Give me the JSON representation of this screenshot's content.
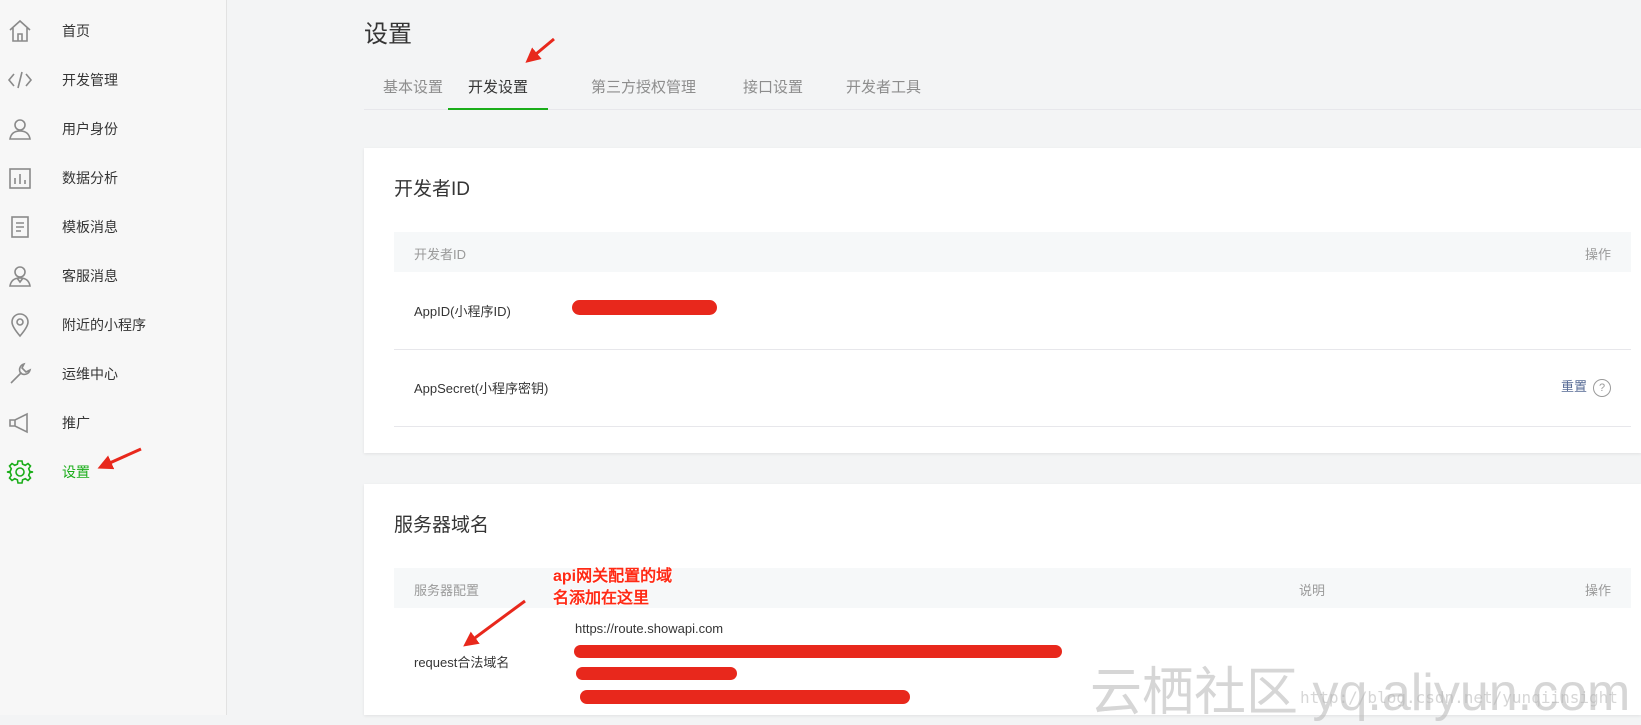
{
  "sidebar": {
    "items": [
      {
        "label": "首页",
        "icon": "home-icon"
      },
      {
        "label": "开发管理",
        "icon": "code-icon"
      },
      {
        "label": "用户身份",
        "icon": "user-icon"
      },
      {
        "label": "数据分析",
        "icon": "bar-chart-icon"
      },
      {
        "label": "模板消息",
        "icon": "document-icon"
      },
      {
        "label": "客服消息",
        "icon": "customer-service-icon"
      },
      {
        "label": "附近的小程序",
        "icon": "location-pin-icon"
      },
      {
        "label": "运维中心",
        "icon": "wrench-icon"
      },
      {
        "label": "推广",
        "icon": "megaphone-icon"
      },
      {
        "label": "设置",
        "icon": "gear-icon",
        "active": true
      }
    ],
    "active_color": "#1aad19"
  },
  "page": {
    "title": "设置"
  },
  "tabs": [
    "基本设置",
    "开发设置",
    "第三方授权管理",
    "接口设置",
    "开发者工具"
  ],
  "active_tab": "开发设置",
  "developer_id": {
    "title": "开发者ID",
    "header": {
      "col1": "开发者ID",
      "action": "操作"
    },
    "rows": {
      "appid_label": "AppID(小程序ID)",
      "secret_label": "AppSecret(小程序密钥)",
      "reset_link": "重置",
      "help_glyph": "?"
    }
  },
  "server_domain": {
    "title": "服务器域名",
    "header": {
      "col1": "服务器配置",
      "desc": "说明",
      "action": "操作"
    },
    "request_label": "request合法域名",
    "domain_first": "https://route.showapi.com"
  },
  "annotation": {
    "line1": "api网关配置的域",
    "line2": "名添加在这里"
  },
  "watermark": {
    "main": "云栖社区 yq.aliyun.com",
    "sub": "http://blog.csdn.net/yunqiinsight"
  },
  "colors": {
    "accent_green": "#1aad19",
    "link_blue": "#576b95",
    "redaction_red": "#e8281c",
    "annotation_red": "#ff2a15"
  }
}
